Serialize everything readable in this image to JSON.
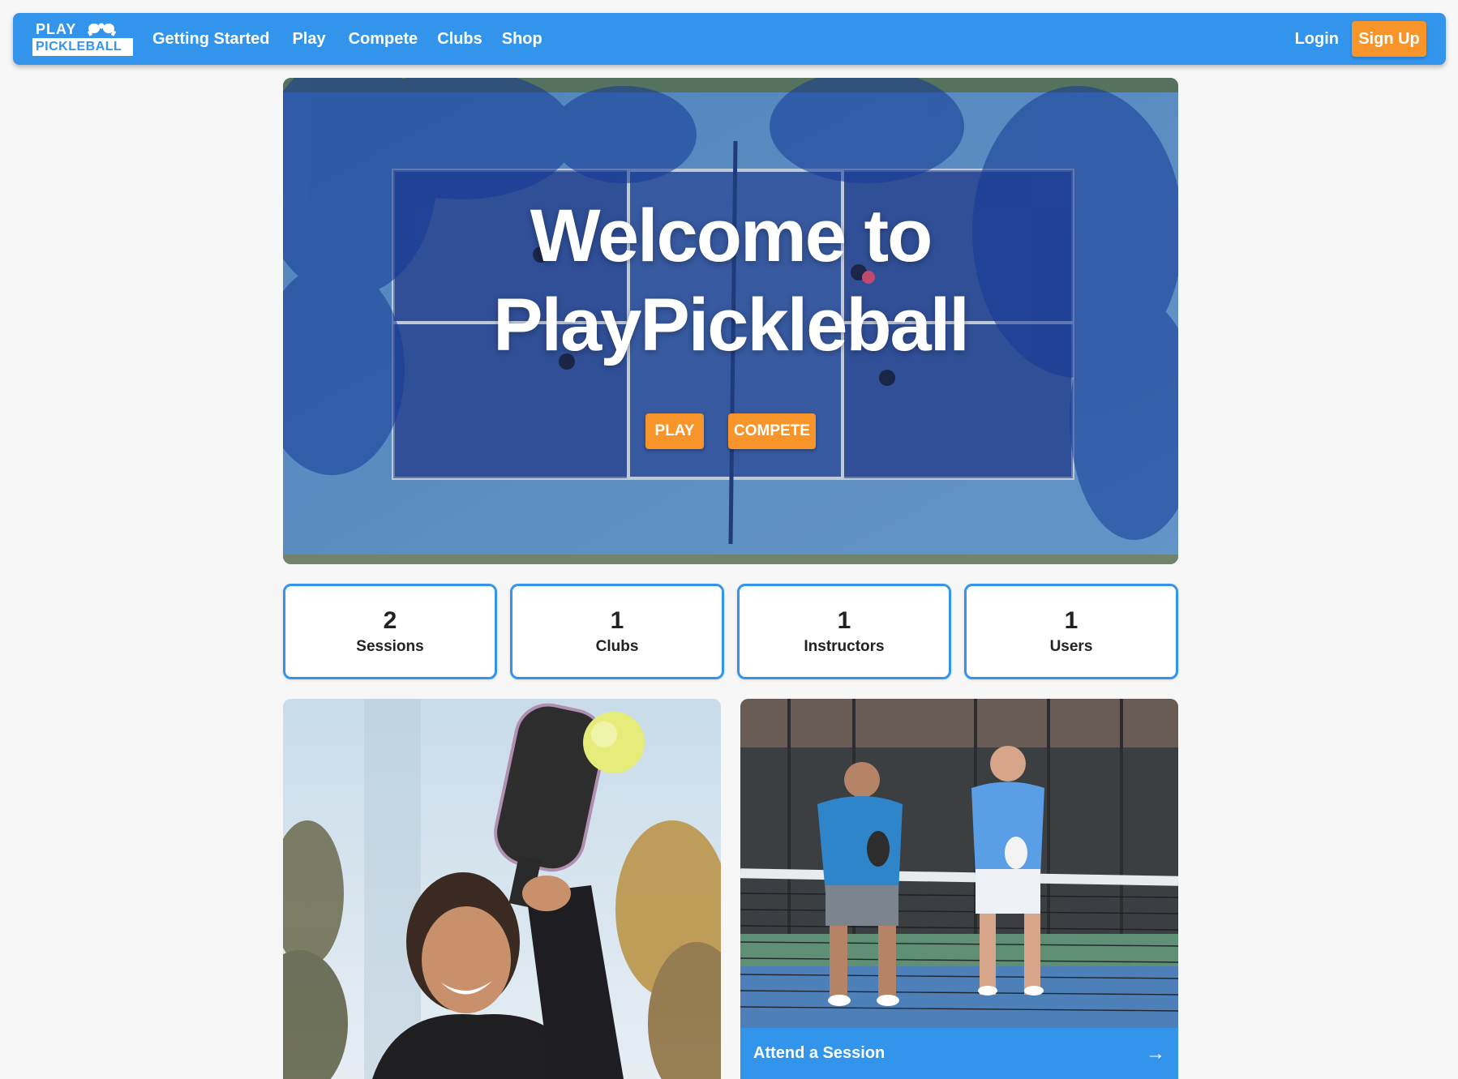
{
  "nav": {
    "logo_top": "PLAY",
    "logo_bottom": "PICKLEBALL",
    "links": [
      {
        "label": "Getting Started"
      },
      {
        "label": "Play"
      },
      {
        "label": "Compete"
      },
      {
        "label": "Clubs"
      },
      {
        "label": "Shop"
      }
    ],
    "login_label": "Login",
    "signup_label": "Sign Up"
  },
  "hero": {
    "title_line1": "Welcome to",
    "title_line2": "PlayPickleball",
    "play_button": "PLAY",
    "compete_button": "COMPETE"
  },
  "stats": [
    {
      "value": "2",
      "label": "Sessions"
    },
    {
      "value": "1",
      "label": "Clubs"
    },
    {
      "value": "1",
      "label": "Instructors"
    },
    {
      "value": "1",
      "label": "Users"
    }
  ],
  "cards": {
    "right_footer_label": "Attend a Session",
    "right_footer_icon": "arrow-right-icon"
  },
  "colors": {
    "primary": "#3394ec",
    "accent": "#f7952a",
    "background": "#f7f7f7"
  }
}
